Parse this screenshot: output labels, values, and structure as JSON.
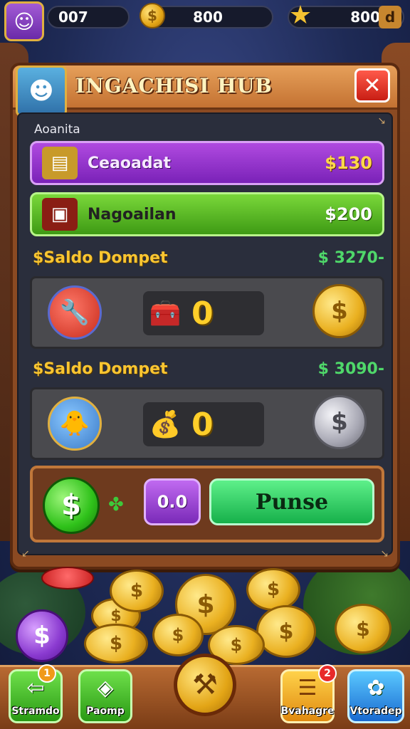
{
  "topbar": {
    "stat1": "007",
    "stat2": "800",
    "stat3": "800",
    "plus_icon": "plus-box-icon"
  },
  "panel": {
    "title": "INGACHISI HUB",
    "close_label": "✕",
    "section_label": "Aoanita"
  },
  "offers": [
    {
      "name": "Ceaoadat",
      "price": "$130",
      "icon": "gold-bars-icon"
    },
    {
      "name": "Nagoailan",
      "price": "$200",
      "icon": "red-chest-icon"
    }
  ],
  "wallets": [
    {
      "label": "$Saldo Dompet",
      "value": "$ 3270-",
      "amount": "0",
      "coin": "gold"
    },
    {
      "label": "$Saldo Dompet",
      "value": "$ 3090-",
      "amount": "0",
      "coin": "silver"
    }
  ],
  "action": {
    "purple_label": "0.0",
    "green_label": "Punse"
  },
  "nav": {
    "btn1_label": "Stramdo",
    "btn2_label": "Paomp",
    "btn4_label": "Bvahagre",
    "btn4_badge": "2",
    "btn5_label": "Vtoradep",
    "btn1_badge": "1"
  },
  "colors": {
    "panel": "#8b4a22",
    "offer_purple": "#9a35d0",
    "offer_green": "#5cbc26",
    "saldo_label": "#f8c531",
    "saldo_value": "#4fd86a",
    "amount": "#ffcf2a"
  }
}
